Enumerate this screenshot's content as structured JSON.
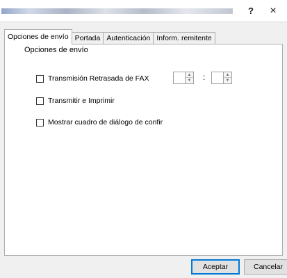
{
  "titlebar": {
    "help_label": "?",
    "close_label": "×"
  },
  "tabs": [
    {
      "label": "Opciones de envío",
      "active": true
    },
    {
      "label": "Portada",
      "active": false
    },
    {
      "label": "Autenticación",
      "active": false
    },
    {
      "label": "Inform. remitente",
      "active": false
    }
  ],
  "group": {
    "title": "Opciones de envío",
    "options": [
      {
        "label": "Transmisión Retrasada de FAX",
        "checked": false
      },
      {
        "label": "Transmitir e Imprimir",
        "checked": false
      },
      {
        "label": "Mostrar cuadro de diálogo de confir",
        "checked": false
      }
    ],
    "time_separator": ":",
    "spinner_up": "▲",
    "spinner_down": "▼"
  },
  "buttons": {
    "ok_label": "Aceptar",
    "cancel_label": "Cancelar"
  },
  "colors": {
    "accent_border": "#0078d7",
    "dialog_background": "#f0f0f0"
  }
}
